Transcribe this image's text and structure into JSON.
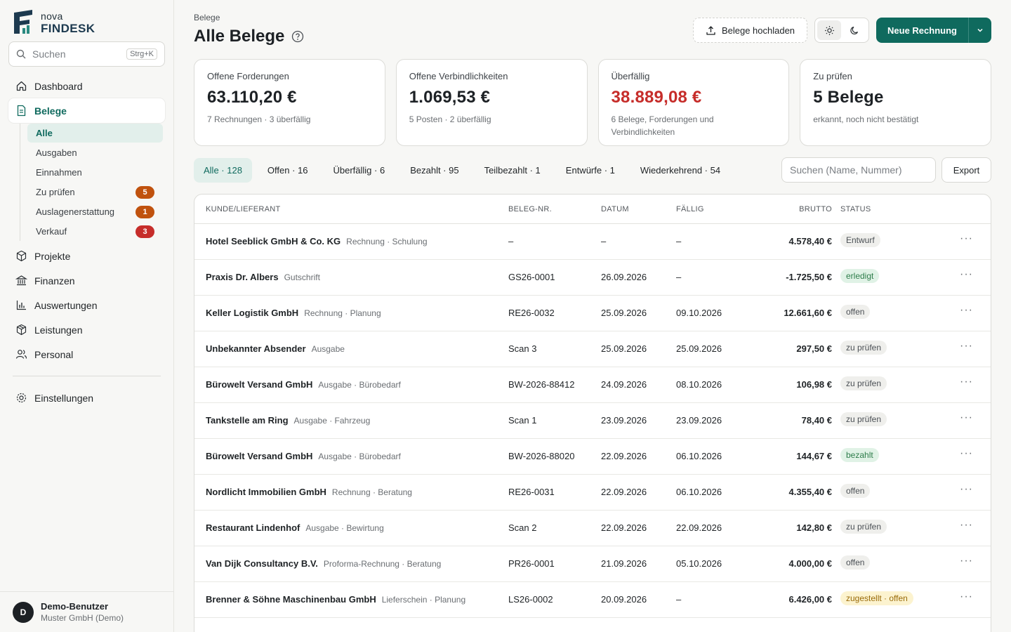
{
  "brand": {
    "line1": "nova",
    "line2": "FINDESK"
  },
  "search": {
    "placeholder": "Suchen",
    "shortcut": "Strg+K"
  },
  "nav": {
    "dashboard": "Dashboard",
    "belege": "Belege",
    "sub": [
      {
        "label": "Alle"
      },
      {
        "label": "Ausgaben"
      },
      {
        "label": "Einnahmen"
      },
      {
        "label": "Zu prüfen",
        "badge": "5",
        "badge_color": "#c0520e"
      },
      {
        "label": "Auslagenerstattung",
        "badge": "1",
        "badge_color": "#c0520e"
      },
      {
        "label": "Verkauf",
        "badge": "3",
        "badge_color": "#c62d2a"
      }
    ],
    "projekte": "Projekte",
    "finanzen": "Finanzen",
    "auswertungen": "Auswertungen",
    "leistungen": "Leistungen",
    "personal": "Personal",
    "einstellungen": "Einstellungen"
  },
  "user": {
    "initial": "D",
    "name": "Demo-Benutzer",
    "company": "Muster GmbH (Demo)"
  },
  "header": {
    "breadcrumb": "Belege",
    "title": "Alle Belege",
    "upload": "Belege hochladen",
    "new_invoice": "Neue Rechnung"
  },
  "cards": [
    {
      "label": "Offene Forderungen",
      "value": "63.110,20 €",
      "sub": "7 Rechnungen · 3 überfällig"
    },
    {
      "label": "Offene Verbindlichkeiten",
      "value": "1.069,53 €",
      "sub": "5 Posten · 2 überfällig"
    },
    {
      "label": "Überfällig",
      "value": "38.889,08 €",
      "sub": "6 Belege, Forderungen und Verbindlichkeiten"
    },
    {
      "label": "Zu prüfen",
      "value": "5 Belege",
      "sub": "erkannt, noch nicht bestätigt"
    }
  ],
  "filters": [
    "Alle · 128",
    "Offen · 16",
    "Überfällig · 6",
    "Bezahlt · 95",
    "Teilbezahlt · 1",
    "Entwürfe · 1",
    "Wiederkehrend · 54"
  ],
  "table_search": {
    "placeholder": "Suchen (Name, Nummer)"
  },
  "export": "Export",
  "table": {
    "headers": {
      "name": "KUNDE/LIEFERANT",
      "num": "BELEG-NR.",
      "date": "DATUM",
      "due": "FÄLLIG",
      "brutto": "BRUTTO",
      "status": "STATUS"
    },
    "rows": [
      {
        "name": "Hotel Seeblick GmbH & Co. KG",
        "type": "Rechnung · Schulung",
        "num": "–",
        "date": "–",
        "due": "–",
        "brutto": "4.578,40 €",
        "status": "Entwurf",
        "tone": "gray"
      },
      {
        "name": "Praxis Dr. Albers",
        "type": "Gutschrift",
        "num": "GS26-0001",
        "date": "26.09.2026",
        "due": "–",
        "brutto": "-1.725,50 €",
        "status": "erledigt",
        "tone": "green"
      },
      {
        "name": "Keller Logistik GmbH",
        "type": "Rechnung · Planung",
        "num": "RE26-0032",
        "date": "25.09.2026",
        "due": "09.10.2026",
        "brutto": "12.661,60 €",
        "status": "offen",
        "tone": "gray"
      },
      {
        "name": "Unbekannter Absender",
        "type": "Ausgabe",
        "num": "Scan 3",
        "date": "25.09.2026",
        "due": "25.09.2026",
        "brutto": "297,50 €",
        "status": "zu prüfen",
        "tone": "gray"
      },
      {
        "name": "Bürowelt Versand GmbH",
        "type": "Ausgabe · Bürobedarf",
        "num": "BW-2026-88412",
        "date": "24.09.2026",
        "due": "08.10.2026",
        "brutto": "106,98 €",
        "status": "zu prüfen",
        "tone": "gray"
      },
      {
        "name": "Tankstelle am Ring",
        "type": "Ausgabe · Fahrzeug",
        "num": "Scan 1",
        "date": "23.09.2026",
        "due": "23.09.2026",
        "brutto": "78,40 €",
        "status": "zu prüfen",
        "tone": "gray"
      },
      {
        "name": "Bürowelt Versand GmbH",
        "type": "Ausgabe · Bürobedarf",
        "num": "BW-2026-88020",
        "date": "22.09.2026",
        "due": "06.10.2026",
        "brutto": "144,67 €",
        "status": "bezahlt",
        "tone": "green"
      },
      {
        "name": "Nordlicht Immobilien GmbH",
        "type": "Rechnung · Beratung",
        "num": "RE26-0031",
        "date": "22.09.2026",
        "due": "06.10.2026",
        "brutto": "4.355,40 €",
        "status": "offen",
        "tone": "gray"
      },
      {
        "name": "Restaurant Lindenhof",
        "type": "Ausgabe · Bewirtung",
        "num": "Scan 2",
        "date": "22.09.2026",
        "due": "22.09.2026",
        "brutto": "142,80 €",
        "status": "zu prüfen",
        "tone": "gray"
      },
      {
        "name": "Van Dijk Consultancy B.V.",
        "type": "Proforma-Rechnung · Beratung",
        "num": "PR26-0001",
        "date": "21.09.2026",
        "due": "05.10.2026",
        "brutto": "4.000,00 €",
        "status": "offen",
        "tone": "gray"
      },
      {
        "name": "Brenner & Söhne Maschinenbau GmbH",
        "type": "Lieferschein · Planung",
        "num": "LS26-0002",
        "date": "20.09.2026",
        "due": "–",
        "brutto": "6.426,00 €",
        "status": "zugestellt · offen",
        "tone": "yellow"
      }
    ]
  },
  "colors": {
    "accent": "#0f6a5e",
    "danger": "#c62d2a",
    "warning": "#c0520e"
  }
}
